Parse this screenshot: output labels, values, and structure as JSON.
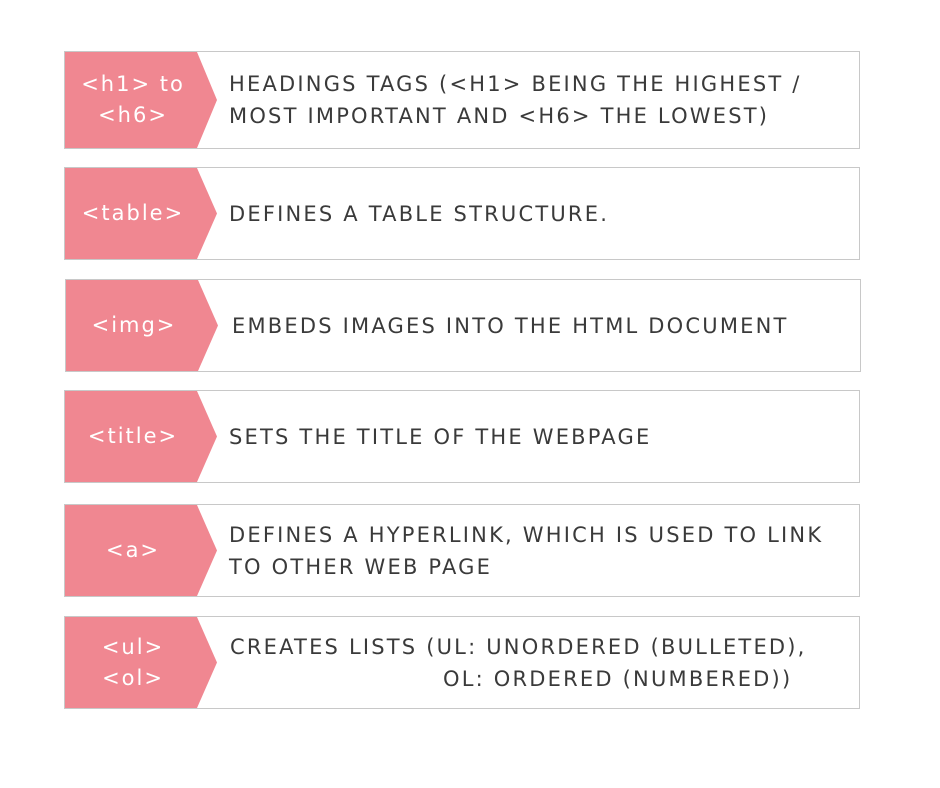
{
  "colors": {
    "tag_fill": "#f08791",
    "border": "#c8c8c8",
    "text": "#3a3a3a"
  },
  "rows": [
    {
      "tag": "<h1> to\n<h6>",
      "description": "HEADINGS TAGS (<H1> BEING THE HIGHEST /\nMOST IMPORTANT AND <H6> THE LOWEST)"
    },
    {
      "tag": "<table>",
      "description": "DEFINES A TABLE STRUCTURE."
    },
    {
      "tag": "<img>",
      "description": "EMBEDS IMAGES INTO THE HTML DOCUMENT"
    },
    {
      "tag": "<title>",
      "description": "SETS THE TITLE OF THE WEBPAGE"
    },
    {
      "tag": "<a>",
      "description": "DEFINES A HYPERLINK, WHICH IS USED TO LINK\nTO OTHER WEB PAGE"
    },
    {
      "tag": "<ul>\n<ol>",
      "description": "CREATES LISTS (UL: UNORDERED (BULLETED),\n                        OL: ORDERED (NUMBERED))"
    }
  ]
}
